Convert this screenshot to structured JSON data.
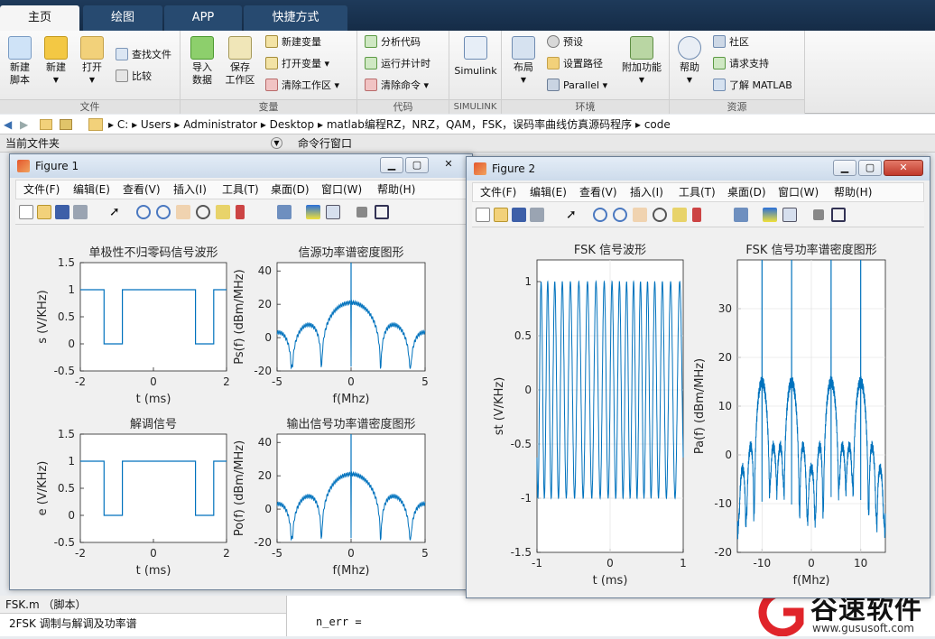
{
  "tabs": [
    "主页",
    "绘图",
    "APP",
    "快捷方式"
  ],
  "ribbon": {
    "file": {
      "new_script": "新建\n脚本",
      "new": "新建",
      "open": "打开",
      "find_files": "查找文件",
      "compare": "比较",
      "group": "文件"
    },
    "variable": {
      "import": "导入\n数据",
      "save_ws": "保存\n工作区",
      "new_var": "新建变量",
      "open_var": "打开变量",
      "clear_ws": "清除工作区",
      "group": "变量"
    },
    "code": {
      "analyze": "分析代码",
      "run_time": "运行并计时",
      "clear_cmd": "清除命令",
      "group": "代码"
    },
    "simulink": {
      "label": "Simulink",
      "group": "SIMULINK"
    },
    "env": {
      "layout": "布局",
      "prefs": "预设",
      "set_path": "设置路径",
      "parallel": "Parallel",
      "addons": "附加功能",
      "group": "环境"
    },
    "resources": {
      "help": "帮助",
      "community": "社区",
      "support": "请求支持",
      "learn": "了解 MATLAB",
      "group": "资源"
    }
  },
  "address": {
    "crumbs": [
      "C:",
      "Users",
      "Administrator",
      "Desktop",
      "matlab编程RZ，NRZ，QAM，FSK，误码率曲线仿真源码程序",
      "code"
    ]
  },
  "panels": {
    "current_folder": "当前文件夹",
    "command_window": "命令行窗口"
  },
  "bottom": {
    "file_tab": "FSK.m （脚本）",
    "comment": "2FSK 调制与解调及功率谱",
    "cmd": "n_err ="
  },
  "watermark": {
    "brand": "谷速软件",
    "url": "www.gususoft.com"
  },
  "fig1": {
    "title": "Figure 1",
    "menu": [
      "文件(F)",
      "编辑(E)",
      "查看(V)",
      "插入(I)",
      "工具(T)",
      "桌面(D)",
      "窗口(W)",
      "帮助(H)"
    ],
    "plots": {
      "p1": {
        "title": "单极性不归零码信号波形",
        "ylabel": "s  (V/KHz)",
        "xlabel": "t (ms)",
        "xticks": [
          "-2",
          "0",
          "2"
        ],
        "yticks": [
          "1.5",
          "1",
          "0.5",
          "0",
          "-0.5"
        ]
      },
      "p2": {
        "title": "信源功率谱密度图形",
        "ylabel": "Ps(f) (dBm/MHz)",
        "xlabel": "f(Mhz)",
        "xticks": [
          "-5",
          "0",
          "5"
        ],
        "yticks": [
          "40",
          "20",
          "0",
          "-20"
        ]
      },
      "p3": {
        "title": "解调信号",
        "ylabel": "e  (V/KHz)",
        "xlabel": "t (ms)",
        "xticks": [
          "-2",
          "0",
          "2"
        ],
        "yticks": [
          "1.5",
          "1",
          "0.5",
          "0",
          "-0.5"
        ]
      },
      "p4": {
        "title": "输出信号功率谱密度图形",
        "ylabel": "Po(f) (dBm/MHz)",
        "xlabel": "f(Mhz)",
        "xticks": [
          "-5",
          "0",
          "5"
        ],
        "yticks": [
          "40",
          "20",
          "0",
          "-20"
        ]
      }
    }
  },
  "fig2": {
    "title": "Figure 2",
    "menu": [
      "文件(F)",
      "编辑(E)",
      "查看(V)",
      "插入(I)",
      "工具(T)",
      "桌面(D)",
      "窗口(W)",
      "帮助(H)"
    ],
    "plots": {
      "p1": {
        "title": "FSK 信号波形",
        "ylabel": "st    (V/KHz)",
        "xlabel": "t (ms)",
        "xticks": [
          "-1",
          "0",
          "1"
        ],
        "yticks": [
          "1",
          "0.5",
          "0",
          "-0.5",
          "-1",
          "-1.5"
        ]
      },
      "p2": {
        "title": "FSK 信号功率谱密度图形",
        "ylabel": "Pa(f) (dBm/MHz)",
        "xlabel": "f(Mhz)",
        "xticks": [
          "-10",
          "0",
          "10"
        ],
        "yticks": [
          "30",
          "20",
          "10",
          "0",
          "-10",
          "-20"
        ]
      }
    }
  },
  "chart_data": [
    {
      "type": "line",
      "title": "单极性不归零码信号波形",
      "xlabel": "t (ms)",
      "ylabel": "s  (V/KHz)",
      "xlim": [
        -2,
        2
      ],
      "ylim": [
        -0.5,
        1.5
      ],
      "x": [
        -2,
        -1.35,
        -1.35,
        -0.85,
        -0.85,
        1.15,
        1.15,
        1.65,
        1.65,
        2
      ],
      "y": [
        1,
        1,
        0,
        0,
        1,
        1,
        0,
        0,
        1,
        1
      ]
    },
    {
      "type": "line",
      "title": "信源功率谱密度图形",
      "xlabel": "f(Mhz)",
      "ylabel": "Ps(f) (dBm/MHz)",
      "xlim": [
        -5,
        5
      ],
      "ylim": [
        -20,
        45
      ],
      "main_lobe_peak": 21,
      "sidelobe_peaks": [
        -1,
        -1
      ],
      "spike": {
        "x": 0,
        "y": 45
      },
      "nulls": [
        -4,
        -2,
        2,
        4
      ]
    },
    {
      "type": "line",
      "title": "解调信号",
      "xlabel": "t (ms)",
      "ylabel": "e  (V/KHz)",
      "xlim": [
        -2,
        2
      ],
      "ylim": [
        -0.5,
        1.5
      ],
      "x": [
        -2,
        -1.35,
        -1.35,
        -0.85,
        -0.85,
        1.15,
        1.15,
        1.65,
        1.65,
        2
      ],
      "y": [
        1,
        1,
        0,
        0,
        1,
        1,
        0,
        0,
        1,
        1
      ]
    },
    {
      "type": "line",
      "title": "输出信号功率谱密度图形",
      "xlabel": "f(Mhz)",
      "ylabel": "Po(f) (dBm/MHz)",
      "xlim": [
        -5,
        5
      ],
      "ylim": [
        -20,
        45
      ],
      "main_lobe_peak": 21,
      "sidelobe_peaks": [
        -1,
        -1
      ],
      "spike": {
        "x": 0,
        "y": 45
      },
      "nulls": [
        -4,
        -2,
        2,
        4
      ]
    },
    {
      "type": "line",
      "title": "FSK 信号波形",
      "xlabel": "t (ms)",
      "ylabel": "st    (V/KHz)",
      "xlim": [
        -1,
        1
      ],
      "ylim": [
        -1.5,
        1.2
      ],
      "cycles": 19,
      "amplitude": 1
    },
    {
      "type": "line",
      "title": "FSK 信号功率谱密度图形",
      "xlabel": "f(Mhz)",
      "ylabel": "Pa(f) (dBm/MHz)",
      "xlim": [
        -15,
        15
      ],
      "ylim": [
        -20,
        40
      ],
      "spikes": [
        -10,
        -4,
        4,
        10
      ],
      "lobe_peak": 15
    }
  ]
}
